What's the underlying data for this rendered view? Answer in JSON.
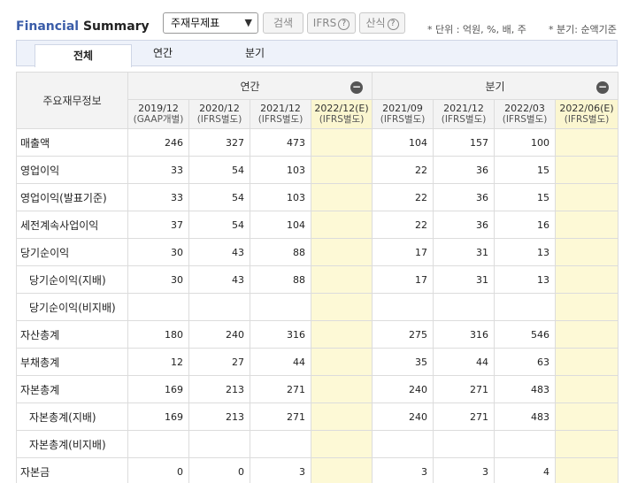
{
  "header": {
    "title_part1": "Financial",
    "title_part2": "Summary",
    "select_value": "주재무제표",
    "search_label": "검색",
    "ifrs_label": "IFRS",
    "formula_label": "산식",
    "help_glyph": "?",
    "unit_note": "* 단위 : 억원, %, 배, 주",
    "quarter_note": "* 분기: 순액기준"
  },
  "tabs": [
    "전체",
    "연간",
    "분기"
  ],
  "table": {
    "item_header": "주요재무정보",
    "annual_group": "연간",
    "quarter_group": "분기",
    "collapse_glyph": "−",
    "periods": [
      {
        "date": "2019/12",
        "basis": "(GAAP개별)"
      },
      {
        "date": "2020/12",
        "basis": "(IFRS별도)"
      },
      {
        "date": "2021/12",
        "basis": "(IFRS별도)"
      },
      {
        "date": "2022/12(E)",
        "basis": "(IFRS별도)"
      },
      {
        "date": "2021/09",
        "basis": "(IFRS별도)"
      },
      {
        "date": "2021/12",
        "basis": "(IFRS별도)"
      },
      {
        "date": "2022/03",
        "basis": "(IFRS별도)"
      },
      {
        "date": "2022/06(E)",
        "basis": "(IFRS별도)"
      }
    ],
    "rows": [
      {
        "label": "매출액",
        "values": [
          "246",
          "327",
          "473",
          "",
          "104",
          "157",
          "100",
          ""
        ]
      },
      {
        "label": "영업이익",
        "values": [
          "33",
          "54",
          "103",
          "",
          "22",
          "36",
          "15",
          ""
        ]
      },
      {
        "label": "영업이익(발표기준)",
        "values": [
          "33",
          "54",
          "103",
          "",
          "22",
          "36",
          "15",
          ""
        ]
      },
      {
        "label": "세전계속사업이익",
        "values": [
          "37",
          "54",
          "104",
          "",
          "22",
          "36",
          "16",
          ""
        ]
      },
      {
        "label": "당기순이익",
        "values": [
          "30",
          "43",
          "88",
          "",
          "17",
          "31",
          "13",
          ""
        ]
      },
      {
        "label": "당기순이익(지배)",
        "values": [
          "30",
          "43",
          "88",
          "",
          "17",
          "31",
          "13",
          ""
        ]
      },
      {
        "label": "당기순이익(비지배)",
        "values": [
          "",
          "",
          "",
          "",
          "",
          "",
          "",
          ""
        ]
      },
      {
        "label": "자산총계",
        "values": [
          "180",
          "240",
          "316",
          "",
          "275",
          "316",
          "546",
          ""
        ]
      },
      {
        "label": "부채총계",
        "values": [
          "12",
          "27",
          "44",
          "",
          "35",
          "44",
          "63",
          ""
        ]
      },
      {
        "label": "자본총계",
        "values": [
          "169",
          "213",
          "271",
          "",
          "240",
          "271",
          "483",
          ""
        ]
      },
      {
        "label": "자본총계(지배)",
        "values": [
          "169",
          "213",
          "271",
          "",
          "240",
          "271",
          "483",
          ""
        ]
      },
      {
        "label": "자본총계(비지배)",
        "values": [
          "",
          "",
          "",
          "",
          "",
          "",
          "",
          ""
        ]
      },
      {
        "label": "자본금",
        "values": [
          "0",
          "0",
          "3",
          "",
          "3",
          "3",
          "4",
          ""
        ]
      }
    ]
  }
}
